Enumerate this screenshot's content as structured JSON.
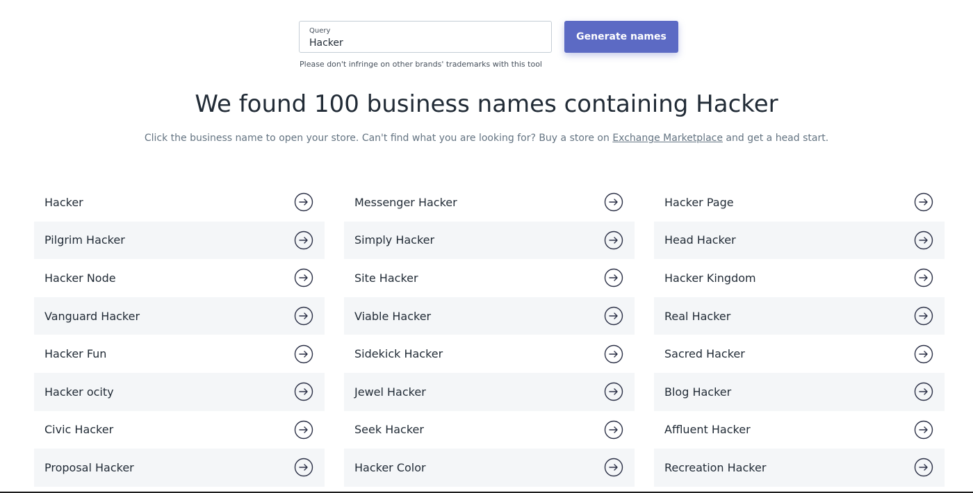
{
  "search": {
    "label": "Query",
    "value": "Hacker",
    "button": "Generate names",
    "disclaimer": "Please don't infringe on other brands' trademarks with this tool"
  },
  "results": {
    "headline": "We found 100 business names containing Hacker",
    "sub_before": "Click the business name to open your store. Can't find what you are looking for? Buy a store on ",
    "sub_link": "Exchange Marketplace",
    "sub_after": " and get a head start."
  },
  "columns": [
    [
      "Hacker",
      "Pilgrim Hacker",
      "Hacker Node",
      "Vanguard Hacker",
      "Hacker Fun",
      "Hacker ocity",
      "Civic Hacker",
      "Proposal Hacker"
    ],
    [
      "Messenger Hacker",
      "Simply Hacker",
      "Site Hacker",
      "Viable Hacker",
      "Sidekick Hacker",
      "Jewel Hacker",
      "Seek Hacker",
      "Hacker Color"
    ],
    [
      "Hacker Page",
      "Head Hacker",
      "Hacker Kingdom",
      "Real Hacker",
      "Sacred Hacker",
      "Blog Hacker",
      "Affluent Hacker",
      "Recreation Hacker"
    ]
  ],
  "icons": {
    "row_action": "arrow-right-circle-icon"
  },
  "colors": {
    "accent": "#5c6ac4",
    "row_shade": "#f4f6f8",
    "text": "#212b36",
    "icon_stroke": "#2a2f45"
  }
}
